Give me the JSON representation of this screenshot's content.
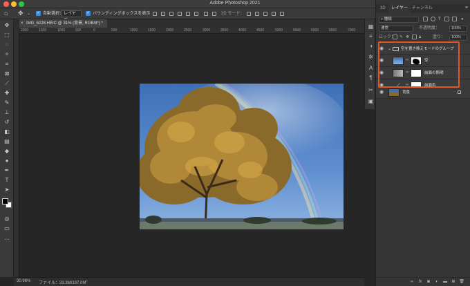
{
  "window": {
    "title": "Adobe Photoshop 2021",
    "traffic_colors": [
      "#ff5f57",
      "#febc2e",
      "#28c840"
    ]
  },
  "options_bar": {
    "auto_select_label": "自動選択：",
    "auto_select_value": "レイヤー",
    "show_transform_label": "バウンディングボックスを表示",
    "mode_3d_label": "3D モード："
  },
  "document": {
    "tab_label": "IMG_6228.HEIC @ 31% (背景, RGB/8*) *",
    "ruler_ticks": [
      "2000",
      "1500",
      "1000",
      "500",
      "0",
      "500",
      "1000",
      "1500",
      "2000",
      "2500",
      "3000",
      "3500",
      "4000",
      "4500",
      "5000",
      "5500",
      "6000",
      "6500",
      "7000"
    ]
  },
  "status": {
    "zoom": "30.96%",
    "file_info": "ファイル：33.3M/197.0M"
  },
  "panel": {
    "tabs": [
      "3D",
      "レイヤー",
      "チャンネル"
    ],
    "active_tab": "レイヤー",
    "filter_kind": "種類",
    "blend_mode": "通常",
    "opacity_label": "不透明度：",
    "opacity_value": "100%",
    "lock_label": "ロック：",
    "fill_label": "塗り：",
    "fill_value": "100%"
  },
  "layers": [
    {
      "name": "空を置き換えモードのグループ",
      "type": "group"
    },
    {
      "name": "空",
      "type": "masked"
    },
    {
      "name": "前面の照明",
      "type": "masked"
    },
    {
      "name": "前面色",
      "type": "adjustment"
    },
    {
      "name": "背景",
      "type": "background"
    }
  ],
  "colors": {
    "highlight": "#e2561f",
    "accent": "#3b8bde",
    "panel_bg": "#353535",
    "canvas_bg": "#262626"
  }
}
